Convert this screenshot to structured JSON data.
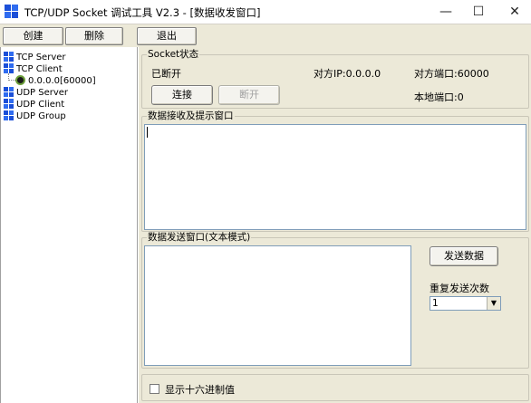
{
  "window": {
    "title": "TCP/UDP Socket 调试工具 V2.3 - [数据收发窗口]",
    "minimize_glyph": "—",
    "maximize_glyph": "☐",
    "close_glyph": "✕"
  },
  "toolbar": {
    "create_label": "创建",
    "delete_label": "删除",
    "exit_label": "退出"
  },
  "tree": {
    "items": [
      {
        "label": "TCP Server",
        "icon": "network-icon"
      },
      {
        "label": "TCP Client",
        "icon": "network-icon"
      },
      {
        "label": "0.0.0.0[60000]",
        "icon": "connection-status-icon"
      },
      {
        "label": "UDP Server",
        "icon": "network-icon"
      },
      {
        "label": "UDP Client",
        "icon": "network-icon"
      },
      {
        "label": "UDP Group",
        "icon": "network-icon"
      }
    ]
  },
  "socket": {
    "group_label": "Socket状态",
    "status": "已断开",
    "remote_ip": "对方IP:0.0.0.0",
    "remote_port": "对方端口:60000",
    "local_port": "本地端口:0",
    "connect_label": "连接",
    "disconnect_label": "断开"
  },
  "receive": {
    "group_label": "数据接收及提示窗口",
    "value": ""
  },
  "send": {
    "group_label": "数据发送窗口(文本模式)",
    "value": "",
    "send_button_label": "发送数据",
    "repeat_label": "重复发送次数",
    "repeat_value": "1"
  },
  "options": {
    "hex_label": "显示十六进制值",
    "hex_checked": false
  },
  "colors": {
    "panel": "#ece9d8",
    "accent_blue": "#1b4fd8"
  }
}
